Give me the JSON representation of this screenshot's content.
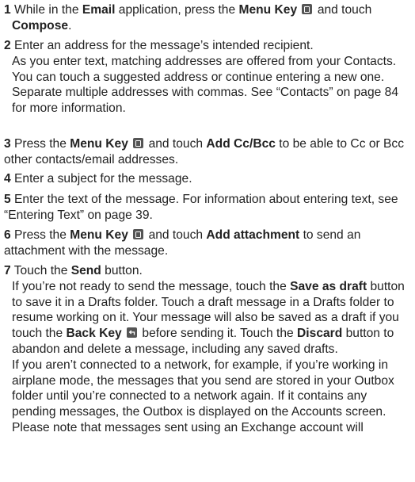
{
  "steps": [
    {
      "num": "1",
      "s1": {
        "t1": "While in the ",
        "b1": "Email",
        "t2": " application, press the ",
        "b2": "Menu Key",
        "icon": "menu-key-icon",
        "t3": " and touch ",
        "b3": "Compose",
        "t4": "."
      }
    },
    {
      "num": "2",
      "s2": {
        "l1": "Enter an address for the message’s intended recipient.",
        "l2": "As you enter text, matching addresses are offered from your Contacts. You can touch a suggested address or continue entering a new one. Separate multiple addresses with commas. See “Contacts” on page 84 for more information."
      }
    },
    {
      "num": "3",
      "s3": {
        "t1": "Press the ",
        "b1": "Menu Key",
        "icon": "menu-key-icon",
        "t2": " and touch ",
        "b2": "Add Cc/Bcc",
        "t3": " to be able to Cc or Bcc other contacts/email addresses."
      }
    },
    {
      "num": "4",
      "s4": {
        "t1": "Enter a subject for the message."
      }
    },
    {
      "num": "5",
      "s5": {
        "t1": "Enter the text of the message. For information about entering text, see “Entering Text” on page 39."
      }
    },
    {
      "num": "6",
      "s6": {
        "t1": "Press the ",
        "b1": "Menu Key",
        "icon": "menu-key-icon",
        "t2": " and touch ",
        "b2": "Add attachment",
        "t3": " to send an attachment with the message."
      }
    },
    {
      "num": "7",
      "s7": {
        "t1": "Touch the ",
        "b1": "Send",
        "t2": " button.",
        "p2": {
          "t1": "If you’re not ready to send the message, touch the ",
          "b1": "Save as draft",
          "t2": " button to save it in a Drafts folder. Touch a draft message in a Drafts folder to resume working on it. Your message will also be saved as a draft if you touch the ",
          "b2": "Back Key",
          "icon": "back-key-icon",
          "t3": " before sending it. Touch the ",
          "b3": "Discard",
          "t4": " button to abandon and delete a message, including any saved drafts."
        },
        "p3": "If you aren’t connected to a network, for example, if you’re working in airplane mode, the messages that you send are stored in your Outbox folder until you’re connected to a network again. If it contains any pending messages, the Outbox is  displayed on the Accounts screen.",
        "p4": "Please note that messages sent using an Exchange account will"
      }
    }
  ]
}
